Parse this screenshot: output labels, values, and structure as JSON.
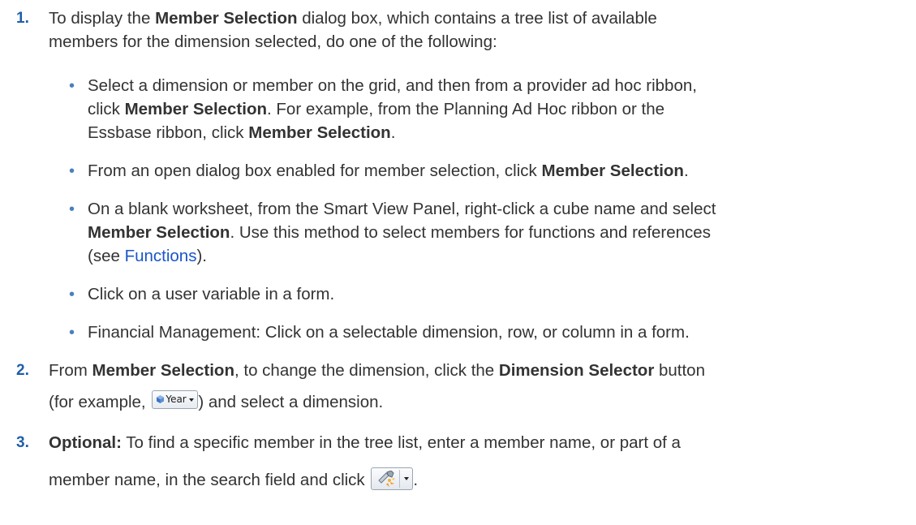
{
  "steps": [
    {
      "number": "1.",
      "lines": [
        {
          "pre": "To display the ",
          "bold": "Member Selection",
          "post": " dialog box, which contains a tree list of available"
        },
        {
          "text": "members for the dimension selected, do one of the following:"
        }
      ],
      "bullets": [
        {
          "lines": [
            {
              "text": "Select a dimension or member on the grid, and then from a provider ad hoc ribbon,"
            },
            {
              "pre": "click ",
              "bold": "Member Selection",
              "post": ". For example, from the Planning Ad Hoc ribbon or the"
            },
            {
              "pre": "Essbase ribbon, click ",
              "bold": "Member Selection",
              "post": "."
            }
          ]
        },
        {
          "lines": [
            {
              "pre": "From an open dialog box enabled for member selection, click ",
              "bold": "Member Selection",
              "post": "."
            }
          ]
        },
        {
          "lines": [
            {
              "text": "On a blank worksheet, from the Smart View Panel, right-click a cube name and select"
            },
            {
              "bold": "Member Selection",
              "post": ". Use this method to select members for functions and references"
            },
            {
              "pre": "(see ",
              "link": "Functions",
              "post": ")."
            }
          ]
        },
        {
          "lines": [
            {
              "text": "Click on a user variable in a form."
            }
          ]
        },
        {
          "lines": [
            {
              "text": "Financial Management: Click on a selectable dimension, row, or column in a form."
            }
          ]
        }
      ]
    },
    {
      "number": "2.",
      "lines": [
        {
          "pre": "From ",
          "bold": "Member Selection",
          "mid": ", to change the dimension, click the ",
          "bold2": "Dimension Selector",
          "post": " button"
        },
        {
          "pre": "(for example, ",
          "post": ") and select a dimension."
        }
      ]
    },
    {
      "number": "3.",
      "lines": [
        {
          "bold": "Optional:",
          "post": " To find a specific member in the tree list, enter a member name, or part of a"
        },
        {
          "pre": "member name, in the search field and click ",
          "post": "."
        }
      ]
    }
  ],
  "year_button": {
    "label": "Year",
    "icon": "dimension-cube-icon",
    "caret": "chevron-down-icon"
  },
  "search_button": {
    "icon": "search-member-icon",
    "caret": "chevron-down-icon"
  },
  "colors": {
    "step_number": "#1f5fa8",
    "bullet": "#4a7fbf",
    "link": "#1a55c8",
    "text": "#333333"
  }
}
